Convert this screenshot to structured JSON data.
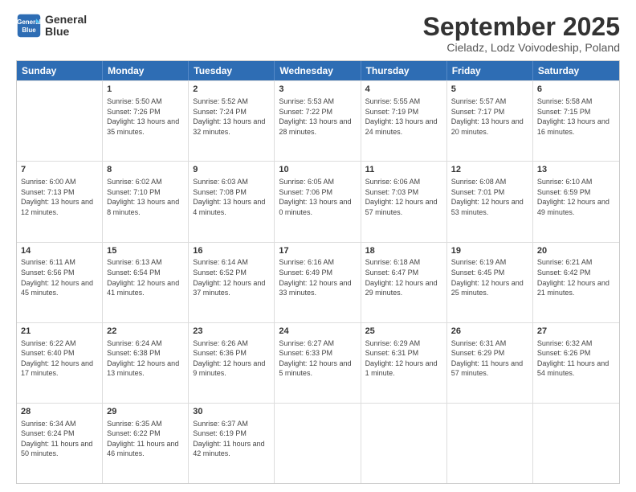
{
  "logo": {
    "line1": "General",
    "line2": "Blue"
  },
  "title": "September 2025",
  "subtitle": "Cieladz, Lodz Voivodeship, Poland",
  "header_days": [
    "Sunday",
    "Monday",
    "Tuesday",
    "Wednesday",
    "Thursday",
    "Friday",
    "Saturday"
  ],
  "weeks": [
    [
      {
        "day": "",
        "sunrise": "",
        "sunset": "",
        "daylight": ""
      },
      {
        "day": "1",
        "sunrise": "Sunrise: 5:50 AM",
        "sunset": "Sunset: 7:26 PM",
        "daylight": "Daylight: 13 hours and 35 minutes."
      },
      {
        "day": "2",
        "sunrise": "Sunrise: 5:52 AM",
        "sunset": "Sunset: 7:24 PM",
        "daylight": "Daylight: 13 hours and 32 minutes."
      },
      {
        "day": "3",
        "sunrise": "Sunrise: 5:53 AM",
        "sunset": "Sunset: 7:22 PM",
        "daylight": "Daylight: 13 hours and 28 minutes."
      },
      {
        "day": "4",
        "sunrise": "Sunrise: 5:55 AM",
        "sunset": "Sunset: 7:19 PM",
        "daylight": "Daylight: 13 hours and 24 minutes."
      },
      {
        "day": "5",
        "sunrise": "Sunrise: 5:57 AM",
        "sunset": "Sunset: 7:17 PM",
        "daylight": "Daylight: 13 hours and 20 minutes."
      },
      {
        "day": "6",
        "sunrise": "Sunrise: 5:58 AM",
        "sunset": "Sunset: 7:15 PM",
        "daylight": "Daylight: 13 hours and 16 minutes."
      }
    ],
    [
      {
        "day": "7",
        "sunrise": "Sunrise: 6:00 AM",
        "sunset": "Sunset: 7:13 PM",
        "daylight": "Daylight: 13 hours and 12 minutes."
      },
      {
        "day": "8",
        "sunrise": "Sunrise: 6:02 AM",
        "sunset": "Sunset: 7:10 PM",
        "daylight": "Daylight: 13 hours and 8 minutes."
      },
      {
        "day": "9",
        "sunrise": "Sunrise: 6:03 AM",
        "sunset": "Sunset: 7:08 PM",
        "daylight": "Daylight: 13 hours and 4 minutes."
      },
      {
        "day": "10",
        "sunrise": "Sunrise: 6:05 AM",
        "sunset": "Sunset: 7:06 PM",
        "daylight": "Daylight: 13 hours and 0 minutes."
      },
      {
        "day": "11",
        "sunrise": "Sunrise: 6:06 AM",
        "sunset": "Sunset: 7:03 PM",
        "daylight": "Daylight: 12 hours and 57 minutes."
      },
      {
        "day": "12",
        "sunrise": "Sunrise: 6:08 AM",
        "sunset": "Sunset: 7:01 PM",
        "daylight": "Daylight: 12 hours and 53 minutes."
      },
      {
        "day": "13",
        "sunrise": "Sunrise: 6:10 AM",
        "sunset": "Sunset: 6:59 PM",
        "daylight": "Daylight: 12 hours and 49 minutes."
      }
    ],
    [
      {
        "day": "14",
        "sunrise": "Sunrise: 6:11 AM",
        "sunset": "Sunset: 6:56 PM",
        "daylight": "Daylight: 12 hours and 45 minutes."
      },
      {
        "day": "15",
        "sunrise": "Sunrise: 6:13 AM",
        "sunset": "Sunset: 6:54 PM",
        "daylight": "Daylight: 12 hours and 41 minutes."
      },
      {
        "day": "16",
        "sunrise": "Sunrise: 6:14 AM",
        "sunset": "Sunset: 6:52 PM",
        "daylight": "Daylight: 12 hours and 37 minutes."
      },
      {
        "day": "17",
        "sunrise": "Sunrise: 6:16 AM",
        "sunset": "Sunset: 6:49 PM",
        "daylight": "Daylight: 12 hours and 33 minutes."
      },
      {
        "day": "18",
        "sunrise": "Sunrise: 6:18 AM",
        "sunset": "Sunset: 6:47 PM",
        "daylight": "Daylight: 12 hours and 29 minutes."
      },
      {
        "day": "19",
        "sunrise": "Sunrise: 6:19 AM",
        "sunset": "Sunset: 6:45 PM",
        "daylight": "Daylight: 12 hours and 25 minutes."
      },
      {
        "day": "20",
        "sunrise": "Sunrise: 6:21 AM",
        "sunset": "Sunset: 6:42 PM",
        "daylight": "Daylight: 12 hours and 21 minutes."
      }
    ],
    [
      {
        "day": "21",
        "sunrise": "Sunrise: 6:22 AM",
        "sunset": "Sunset: 6:40 PM",
        "daylight": "Daylight: 12 hours and 17 minutes."
      },
      {
        "day": "22",
        "sunrise": "Sunrise: 6:24 AM",
        "sunset": "Sunset: 6:38 PM",
        "daylight": "Daylight: 12 hours and 13 minutes."
      },
      {
        "day": "23",
        "sunrise": "Sunrise: 6:26 AM",
        "sunset": "Sunset: 6:36 PM",
        "daylight": "Daylight: 12 hours and 9 minutes."
      },
      {
        "day": "24",
        "sunrise": "Sunrise: 6:27 AM",
        "sunset": "Sunset: 6:33 PM",
        "daylight": "Daylight: 12 hours and 5 minutes."
      },
      {
        "day": "25",
        "sunrise": "Sunrise: 6:29 AM",
        "sunset": "Sunset: 6:31 PM",
        "daylight": "Daylight: 12 hours and 1 minute."
      },
      {
        "day": "26",
        "sunrise": "Sunrise: 6:31 AM",
        "sunset": "Sunset: 6:29 PM",
        "daylight": "Daylight: 11 hours and 57 minutes."
      },
      {
        "day": "27",
        "sunrise": "Sunrise: 6:32 AM",
        "sunset": "Sunset: 6:26 PM",
        "daylight": "Daylight: 11 hours and 54 minutes."
      }
    ],
    [
      {
        "day": "28",
        "sunrise": "Sunrise: 6:34 AM",
        "sunset": "Sunset: 6:24 PM",
        "daylight": "Daylight: 11 hours and 50 minutes."
      },
      {
        "day": "29",
        "sunrise": "Sunrise: 6:35 AM",
        "sunset": "Sunset: 6:22 PM",
        "daylight": "Daylight: 11 hours and 46 minutes."
      },
      {
        "day": "30",
        "sunrise": "Sunrise: 6:37 AM",
        "sunset": "Sunset: 6:19 PM",
        "daylight": "Daylight: 11 hours and 42 minutes."
      },
      {
        "day": "",
        "sunrise": "",
        "sunset": "",
        "daylight": ""
      },
      {
        "day": "",
        "sunrise": "",
        "sunset": "",
        "daylight": ""
      },
      {
        "day": "",
        "sunrise": "",
        "sunset": "",
        "daylight": ""
      },
      {
        "day": "",
        "sunrise": "",
        "sunset": "",
        "daylight": ""
      }
    ]
  ]
}
